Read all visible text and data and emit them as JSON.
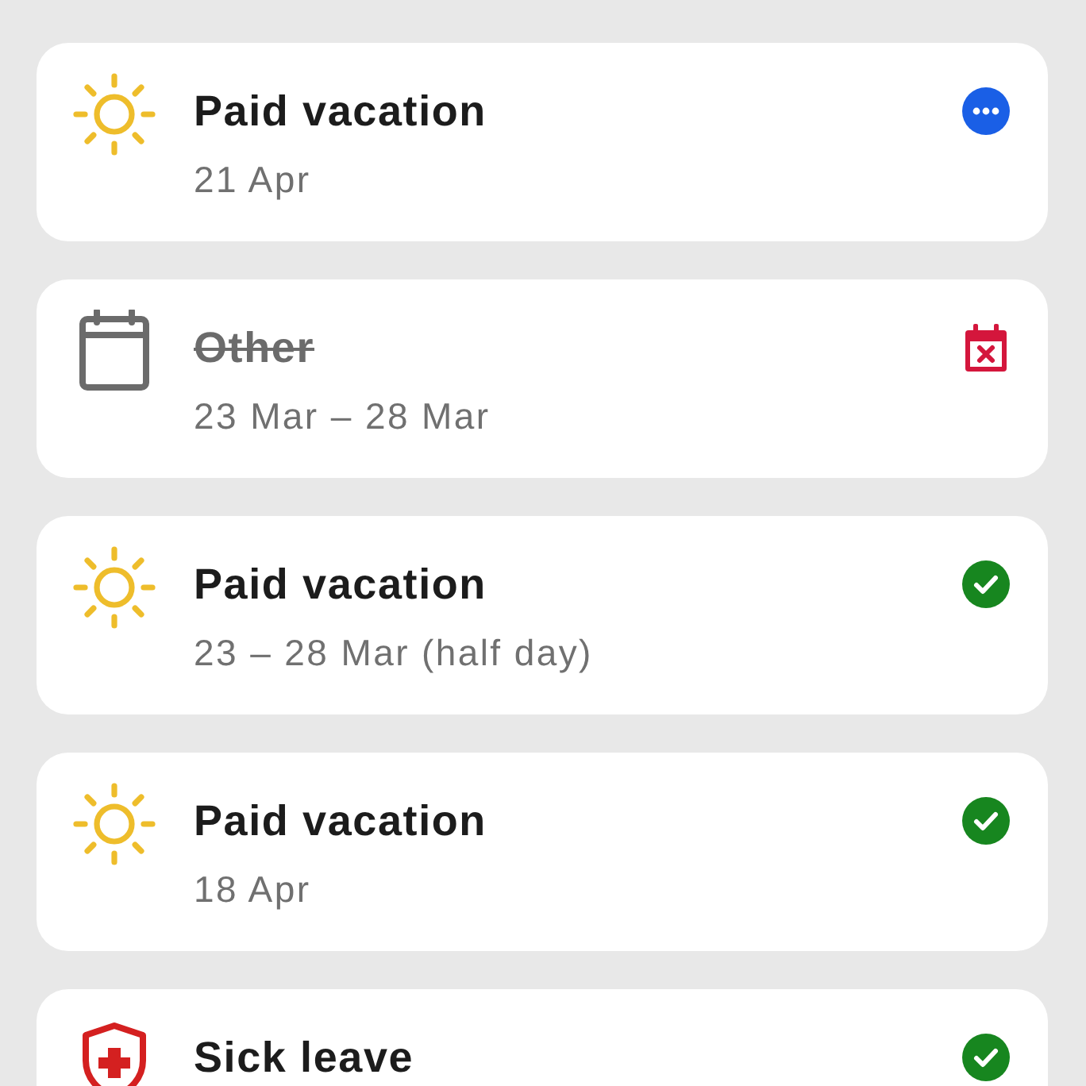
{
  "requests": [
    {
      "kind": "vacation",
      "title": "Paid vacation",
      "cancelled": false,
      "subtitle": "21 Apr",
      "status": {
        "kind": "pending"
      }
    },
    {
      "kind": "other",
      "title": "Other",
      "cancelled": true,
      "subtitle": "23 Mar – 28 Mar",
      "status": {
        "kind": "cancelled"
      }
    },
    {
      "kind": "vacation",
      "title": "Paid vacation",
      "cancelled": false,
      "subtitle": "23 – 28 Mar (half day)",
      "status": {
        "kind": "approved"
      }
    },
    {
      "kind": "vacation",
      "title": "Paid vacation",
      "cancelled": false,
      "subtitle": "18 Apr",
      "status": {
        "kind": "approved"
      }
    },
    {
      "kind": "sick",
      "title": "Sick leave",
      "cancelled": false,
      "status": {
        "kind": "approved"
      }
    }
  ]
}
